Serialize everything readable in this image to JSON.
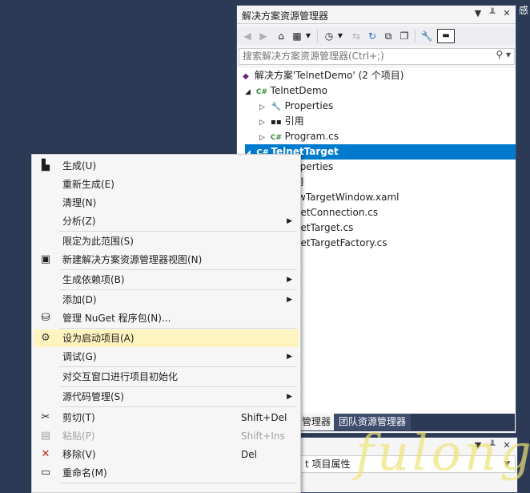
{
  "solution_explorer": {
    "title": "解决方案资源管理器",
    "title_buttons": [
      "▼",
      "╨",
      "✕"
    ],
    "search_placeholder": "搜索解决方案资源管理器(Ctrl+;)",
    "tree": [
      {
        "label": "解决方案'TelnetDemo' (2 个项目)",
        "icon": "solution-icon"
      },
      {
        "label": "TelnetDemo",
        "icon": "csharp-project-icon"
      },
      {
        "label": "Properties",
        "icon": "wrench-icon"
      },
      {
        "label": "引用",
        "icon": "references-icon"
      },
      {
        "label": "Program.cs",
        "icon": "csharp-file-icon"
      },
      {
        "label": "TelnetTarget",
        "icon": "csharp-project-icon",
        "selected": true
      },
      {
        "label": "Properties",
        "icon": "wrench-icon"
      },
      {
        "label": "引用",
        "icon": "references-icon"
      },
      {
        "label": "NewTargetWindow.xaml",
        "icon": "xaml-file-icon"
      },
      {
        "label": "TelnetConnection.cs",
        "icon": "csharp-file-icon"
      },
      {
        "label": "TelnetTarget.cs",
        "icon": "csharp-file-icon"
      },
      {
        "label": "TelnetTargetFactory.cs",
        "icon": "csharp-file-icon"
      }
    ],
    "tabs": [
      "管理器",
      "团队资源管理器"
    ]
  },
  "properties_panel": {
    "combo_text": "t  项目属性"
  },
  "context_menu": {
    "items": [
      {
        "label": "生成(U)",
        "icon": "build-icon"
      },
      {
        "label": "重新生成(E)"
      },
      {
        "label": "清理(N)"
      },
      {
        "label": "分析(Z)",
        "submenu": true
      },
      {
        "label": "限定为此范围(S)"
      },
      {
        "label": "新建解决方案资源管理器视图(N)",
        "icon": "new-view-icon"
      },
      {
        "label": "生成依赖项(B)",
        "submenu": true
      },
      {
        "label": "添加(D)",
        "submenu": true
      },
      {
        "label": "管理 NuGet 程序包(N)...",
        "icon": "nuget-icon"
      },
      {
        "label": "设为启动项目(A)",
        "icon": "gear-icon",
        "highlighted": true
      },
      {
        "label": "调试(G)",
        "submenu": true
      },
      {
        "label": "对交互窗口进行项目初始化"
      },
      {
        "label": "源代码管理(S)",
        "submenu": true
      },
      {
        "label": "剪切(T)",
        "shortcut": "Shift+Del",
        "icon": "scissors-icon"
      },
      {
        "label": "粘贴(P)",
        "shortcut": "Shift+Ins",
        "icon": "paste-icon",
        "disabled": true
      },
      {
        "label": "移除(V)",
        "shortcut": "Del",
        "icon": "remove-icon"
      },
      {
        "label": "重命名(M)",
        "icon": "rename-icon"
      }
    ]
  },
  "watermark": "fulong",
  "right_edge_text": "感",
  "colors": {
    "background": "#2d3a55",
    "selection": "#007acc",
    "menu_highlight": "#fdf4bf"
  }
}
